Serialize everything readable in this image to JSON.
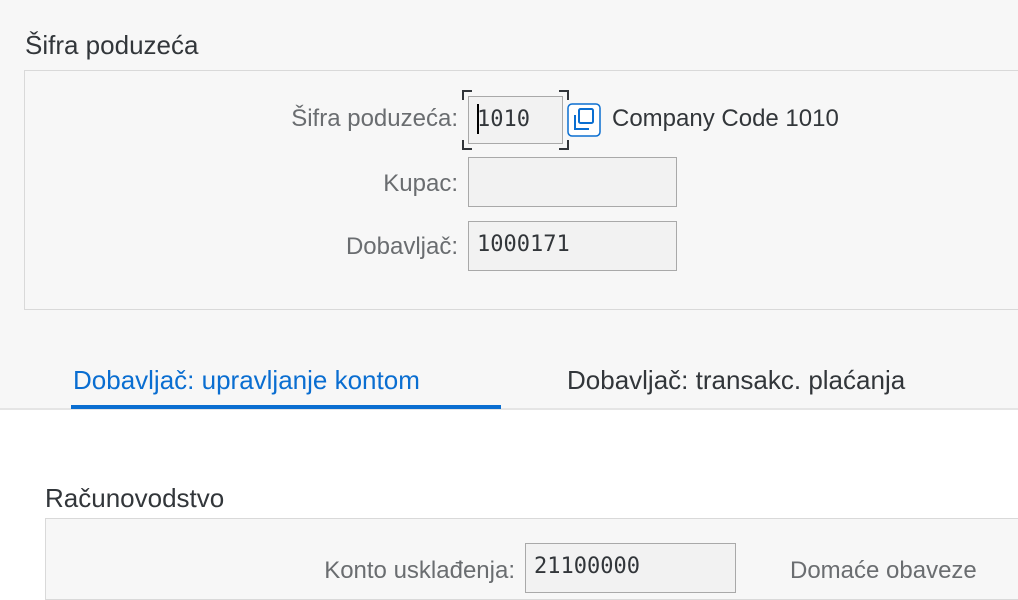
{
  "header": {
    "section_title": "Šifra poduzeća",
    "fields": {
      "company_code": {
        "label": "Šifra poduzeća:",
        "value": "1010",
        "description": "Company Code 1010"
      },
      "customer": {
        "label": "Kupac:",
        "value": ""
      },
      "vendor": {
        "label": "Dobavljač:",
        "value": "1000171"
      }
    }
  },
  "tabs": [
    {
      "label": "Dobavljač: upravljanje kontom",
      "active": true
    },
    {
      "label": "Dobavljač: transakc. plaćanja",
      "active": false
    }
  ],
  "accounting": {
    "section_title": "Računovodstvo",
    "fields": {
      "reconciliation_account": {
        "label": "Konto usklađenja:",
        "value": "21100000",
        "description": "Domaće obaveze"
      }
    }
  },
  "colors": {
    "accent": "#0a6ed1",
    "panel_bg": "#f7f7f7",
    "field_bg": "#f2f2f2"
  },
  "icons": {
    "value_help": "value-help-icon"
  }
}
